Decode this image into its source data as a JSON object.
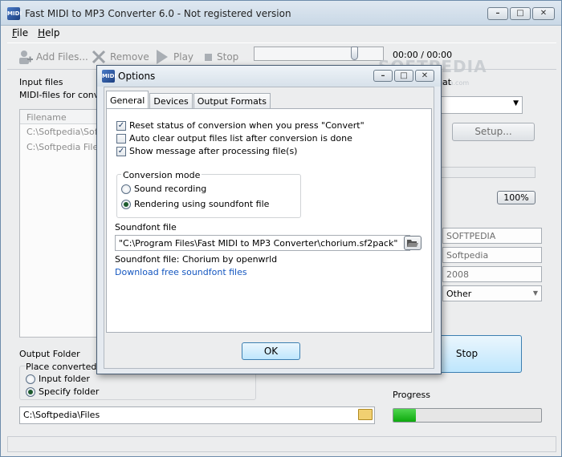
{
  "window": {
    "title": "Fast MIDI to MP3 Converter 6.0 - Not registered version",
    "icon": "app-icon"
  },
  "menu": [
    {
      "prefix": "",
      "underline": "F",
      "rest": "ile"
    },
    {
      "prefix": "",
      "underline": "H",
      "rest": "elp"
    }
  ],
  "toolbar": {
    "add_label": "Add Files...",
    "remove_label": "Remove",
    "play_label": "Play",
    "stop_label": "Stop",
    "time": "00:00 / 00:00"
  },
  "watermark": {
    "text": "SOFTPEDIA",
    "sub": "www.softpedia.com"
  },
  "input": {
    "label": "Input files",
    "sublabel": "MIDI-files for conver",
    "column_header": "Filename",
    "files": [
      "C:\\Softpedia\\Softp",
      "C:\\Softpedia Files\\"
    ]
  },
  "right_panel": {
    "format_label": "at",
    "setup_label": "Setup...",
    "volume": "100%",
    "fields": [
      "SOFTPEDIA",
      "Softpedia",
      "2008"
    ],
    "genre": "Other",
    "stop_label": "Stop"
  },
  "output": {
    "label": "Output Folder",
    "group_label": "Place converted fil",
    "options": [
      "Input folder",
      "Specify folder"
    ],
    "selected": 1,
    "path": "C:\\Softpedia\\Files"
  },
  "progress": {
    "label": "Progress",
    "value": 0.15
  },
  "dialog": {
    "title": "Options",
    "tabs": [
      "General",
      "Devices",
      "Output Formats"
    ],
    "active_tab": 0,
    "checks": [
      {
        "label": "Reset status of conversion when you press \"Convert\"",
        "checked": true
      },
      {
        "label": "Auto clear output files list after conversion is done",
        "checked": false
      },
      {
        "label": "Show message after processing file(s)",
        "checked": true
      }
    ],
    "mode_label": "Conversion mode",
    "modes": [
      {
        "label": "Sound recording",
        "selected": false
      },
      {
        "label": "Rendering using soundfont file",
        "selected": true
      }
    ],
    "soundfont_label": "Soundfont file",
    "soundfont_path": "\"C:\\Program Files\\Fast MIDI to MP3 Converter\\chorium.sf2pack\"",
    "soundfont_info": "Soundfont file: Chorium by openwrld",
    "download_link": "Download free soundfont files",
    "ok_label": "OK"
  }
}
